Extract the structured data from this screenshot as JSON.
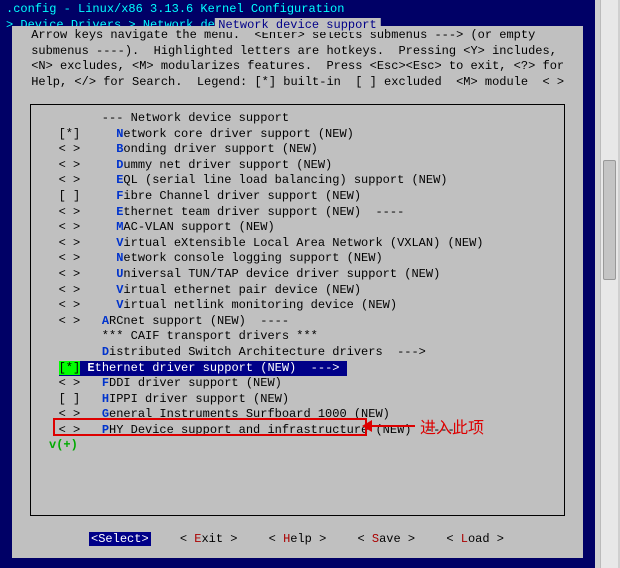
{
  "window": {
    "title": ".config - Linux/x86 3.13.6 Kernel Configuration",
    "breadcrumb_prefix": "  > ",
    "breadcrumb_path1": "Device Drivers",
    "breadcrumb_sep": " > ",
    "breadcrumb_path2": "Network device support",
    "breadcrumb_suffix": " ─────"
  },
  "section": {
    "title": "Network device support",
    "help_lines": " Arrow keys navigate the menu.  <Enter> selects submenus ---> (or empty\n submenus ----).  Highlighted letters are hotkeys.  Pressing <Y> includes,\n <N> excludes, <M> modularizes features.  Press <Esc><Esc> to exit, <?> for\n Help, </> for Search.  Legend: [*] built-in  [ ] excluded  <M> module  < >"
  },
  "menu": {
    "items": [
      {
        "sel": "   ",
        "hot": "",
        "label": "--- Network device support"
      },
      {
        "sel": "[*]",
        "hot": "N",
        "label": "etwork core driver support (NEW)"
      },
      {
        "sel": "< >",
        "hot": "B",
        "label": "onding driver support (NEW)"
      },
      {
        "sel": "< >",
        "hot": "D",
        "label": "ummy net driver support (NEW)"
      },
      {
        "sel": "< >",
        "hot": "E",
        "label": "QL (serial line load balancing) support (NEW)"
      },
      {
        "sel": "[ ]",
        "hot": "F",
        "label": "ibre Channel driver support (NEW)"
      },
      {
        "sel": "< >",
        "hot": "E",
        "label": "thernet team driver support (NEW)  ----"
      },
      {
        "sel": "< >",
        "hot": "M",
        "label": "AC-VLAN support (NEW)"
      },
      {
        "sel": "< >",
        "hot": "V",
        "label": "irtual eXtensible Local Area Network (VXLAN) (NEW)"
      },
      {
        "sel": "< >",
        "hot": "N",
        "label": "etwork console logging support (NEW)"
      },
      {
        "sel": "< >",
        "hot": "U",
        "label": "niversal TUN/TAP device driver support (NEW)"
      },
      {
        "sel": "< >",
        "hot": "V",
        "label": "irtual ethernet pair device (NEW)"
      },
      {
        "sel": "< >",
        "hot": "V",
        "label": "irtual netlink monitoring device (NEW)"
      },
      {
        "sel": "< >",
        "hot": "A",
        "label": "RCnet support (NEW)  ----"
      },
      {
        "sel": "   ",
        "hot": "",
        "label": "*** CAIF transport drivers ***"
      },
      {
        "sel": "   ",
        "hot": "D",
        "label": "istributed Switch Architecture drivers  --->"
      },
      {
        "sel": "[*]",
        "hot": "E",
        "label": "thernet driver support (NEW)  --->",
        "selected": true
      },
      {
        "sel": "< >",
        "hot": "F",
        "label": "DDI driver support (NEW)"
      },
      {
        "sel": "[ ]",
        "hot": "H",
        "label": "IPPI driver support (NEW)"
      },
      {
        "sel": "< >",
        "hot": "G",
        "label": "eneral Instruments Surfboard 1000 (NEW)"
      },
      {
        "sel": "< >",
        "hot": "P",
        "label": "HY Device support and infrastructure (NEW)  ----"
      }
    ],
    "more": "v(+)"
  },
  "buttons": {
    "select": "<Select>",
    "exit_pre": "< ",
    "exit_hot": "E",
    "exit_post": "xit >",
    "help_pre": "< ",
    "help_hot": "H",
    "help_post": "elp >",
    "save_pre": "< ",
    "save_hot": "S",
    "save_post": "ave >",
    "load_pre": "< ",
    "load_hot": "L",
    "load_post": "oad >"
  },
  "annotation": {
    "text": "进入此项"
  }
}
